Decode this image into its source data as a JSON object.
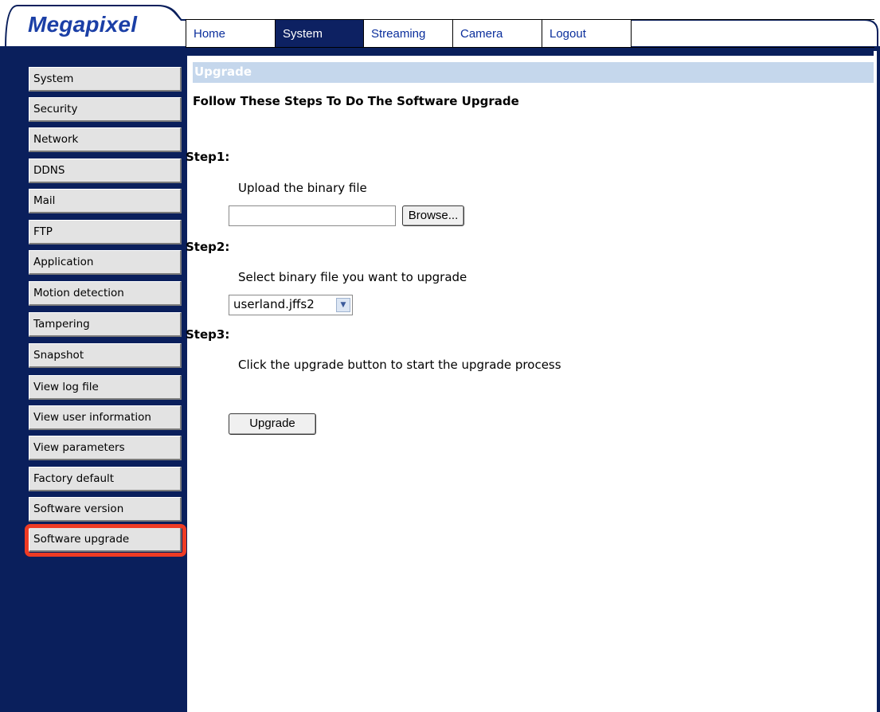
{
  "header": {
    "logo": "Megapixel",
    "nav_tabs": [
      {
        "label": "Home",
        "active": false
      },
      {
        "label": "System",
        "active": true
      },
      {
        "label": "Streaming",
        "active": false
      },
      {
        "label": "Camera",
        "active": false
      },
      {
        "label": "Logout",
        "active": false
      }
    ]
  },
  "sidebar": {
    "items": [
      {
        "label": "System"
      },
      {
        "label": "Security"
      },
      {
        "label": "Network"
      },
      {
        "label": "DDNS"
      },
      {
        "label": "Mail"
      },
      {
        "label": "FTP"
      },
      {
        "label": "Application"
      },
      {
        "label": "Motion detection"
      },
      {
        "label": "Tampering"
      },
      {
        "label": "Snapshot"
      },
      {
        "label": "View log file"
      },
      {
        "label": "View user information"
      },
      {
        "label": "View parameters"
      },
      {
        "label": "Factory default"
      },
      {
        "label": "Software version"
      },
      {
        "label": "Software upgrade",
        "highlighted": true
      }
    ]
  },
  "main": {
    "section_title": "Upgrade",
    "heading": "Follow These Steps To Do The Software Upgrade",
    "step1": {
      "title": "Step1:",
      "description": "Upload the binary file",
      "file_value": "",
      "browse_label": "Browse..."
    },
    "step2": {
      "title": "Step2:",
      "description": "Select binary file you want to upgrade",
      "selected": "userland.jffs2"
    },
    "step3": {
      "title": "Step3:",
      "description": "Click the upgrade button to start the upgrade process",
      "button_label": "Upgrade"
    }
  },
  "colors": {
    "navy": "#0a1f5c",
    "logo_blue": "#1b3fa6",
    "title_band": "#c5d7ec",
    "highlight": "#ee3b24"
  }
}
